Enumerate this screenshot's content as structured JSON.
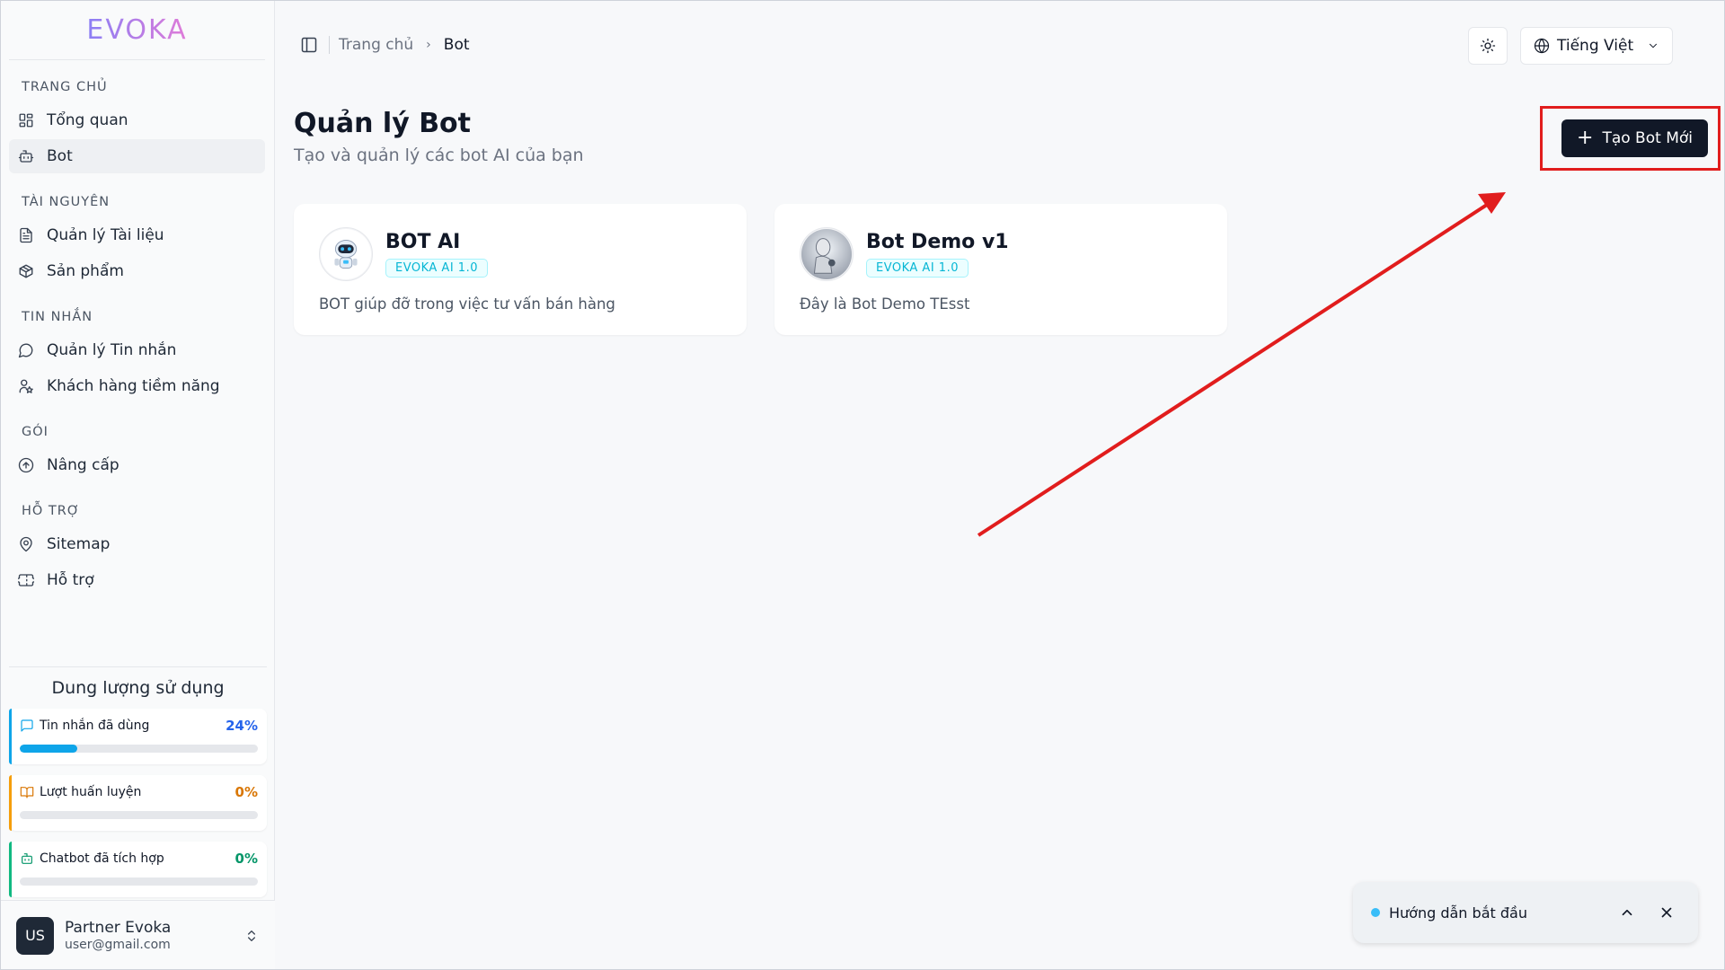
{
  "brand": {
    "logo_text": "EVOKA"
  },
  "sidebar": {
    "sections": [
      {
        "title": "TRANG CHỦ",
        "items": [
          {
            "label": "Tổng quan",
            "icon": "dashboard-icon"
          },
          {
            "label": "Bot",
            "icon": "bot-icon",
            "active": true
          }
        ]
      },
      {
        "title": "TÀI NGUYÊN",
        "items": [
          {
            "label": "Quản lý Tài liệu",
            "icon": "document-icon"
          },
          {
            "label": "Sản phẩm",
            "icon": "package-icon"
          }
        ]
      },
      {
        "title": "TIN NHẮN",
        "items": [
          {
            "label": "Quản lý Tin nhắn",
            "icon": "message-icon"
          },
          {
            "label": "Khách hàng tiềm năng",
            "icon": "user-star-icon"
          }
        ]
      },
      {
        "title": "GÓI",
        "items": [
          {
            "label": "Nâng cấp",
            "icon": "upgrade-icon"
          }
        ]
      },
      {
        "title": "HỖ TRỢ",
        "items": [
          {
            "label": "Sitemap",
            "icon": "map-pin-icon"
          },
          {
            "label": "Hỗ trợ",
            "icon": "ticket-icon"
          }
        ]
      }
    ]
  },
  "usage": {
    "title": "Dung lượng sử dụng",
    "items": [
      {
        "label": "Tin nhắn đã dùng",
        "percent_text": "24%",
        "fraction": 0.24,
        "color": "#0ea5e9",
        "pct_color": "#2563eb",
        "icon": "chat-icon"
      },
      {
        "label": "Lượt huấn luyện",
        "percent_text": "0%",
        "fraction": 0,
        "color": "#f59e0b",
        "pct_color": "#d97706",
        "icon": "book-icon"
      },
      {
        "label": "Chatbot đã tích hợp",
        "percent_text": "0%",
        "fraction": 0,
        "color": "#10b981",
        "pct_color": "#059669",
        "icon": "bot-icon"
      }
    ]
  },
  "user": {
    "initials": "US",
    "name": "Partner Evoka",
    "email": "user@gmail.com"
  },
  "header": {
    "breadcrumb": [
      "Trang chủ",
      "Bot"
    ],
    "language": "Tiếng Việt"
  },
  "main": {
    "title": "Quản lý Bot",
    "subtitle": "Tạo và quản lý các bot AI của bạn",
    "create_button": "Tạo Bot Mới",
    "bots": [
      {
        "name": "BOT AI",
        "tag": "EVOKA AI 1.0",
        "description": "BOT giúp đỡ trong việc tư vấn bán hàng"
      },
      {
        "name": "Bot Demo v1",
        "tag": "EVOKA AI 1.0",
        "description": "Đây là Bot Demo TEsst"
      }
    ]
  },
  "guide": {
    "label": "Hướng dẫn bắt đầu"
  },
  "colors": {
    "accent": "#111827",
    "annotation": "#e11d1d",
    "tag": "#06b6d4"
  }
}
